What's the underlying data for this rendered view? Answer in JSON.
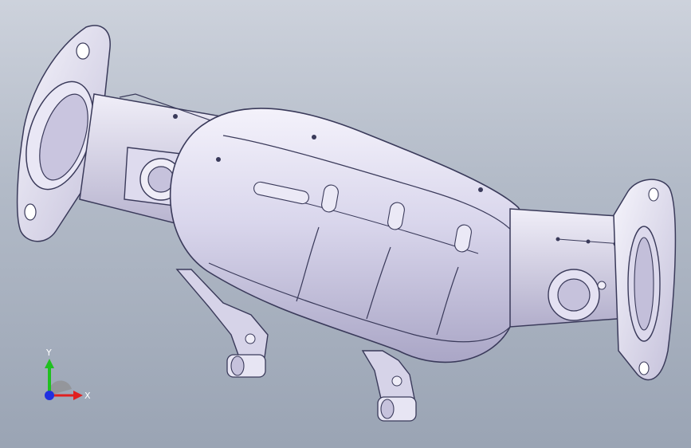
{
  "viewport": {
    "background_top": "#cdd2dc",
    "background_bottom": "#9aa4b4",
    "model_name": "catalytic-converter"
  },
  "triad": {
    "x_label": "X",
    "y_label": "Y",
    "x_color": "#e02020",
    "y_color": "#20c020",
    "z_color": "#2030e0"
  }
}
